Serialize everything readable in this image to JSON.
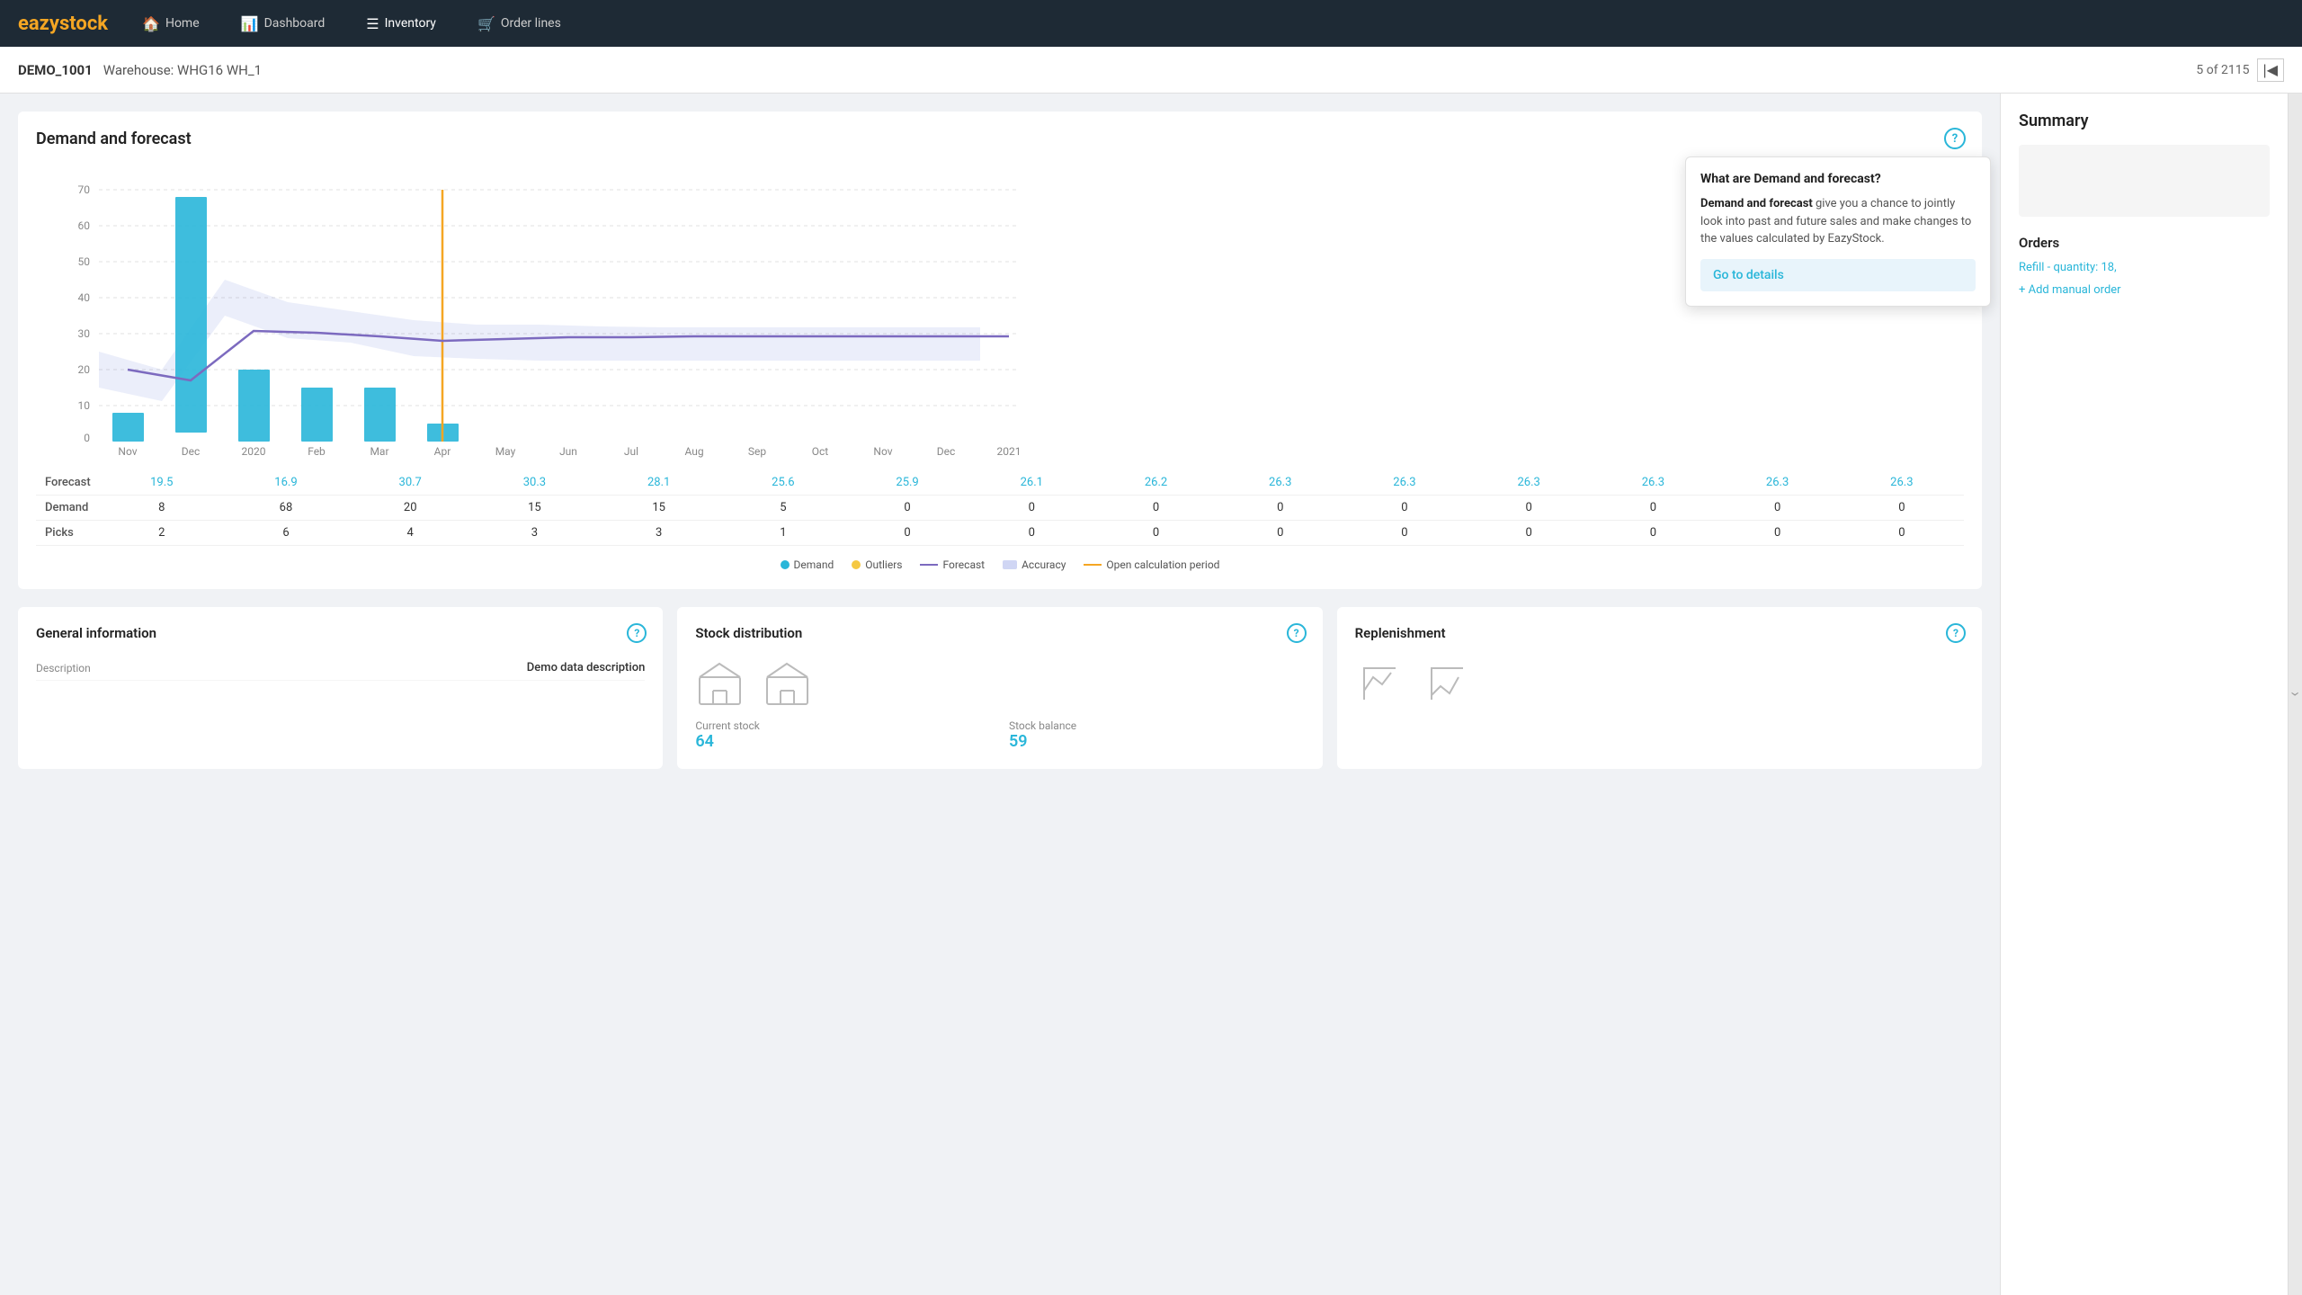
{
  "brand": {
    "name_plain": "eazy",
    "name_accent": "stock",
    "logo_text": "eazystock"
  },
  "navbar": {
    "items": [
      {
        "id": "home",
        "icon": "🏠",
        "label": "Home"
      },
      {
        "id": "dashboard",
        "icon": "📊",
        "label": "Dashboard"
      },
      {
        "id": "inventory",
        "icon": "≡",
        "label": "Inventory"
      },
      {
        "id": "orderlines",
        "icon": "🛒",
        "label": "Order lines"
      }
    ]
  },
  "breadcrumb": {
    "item_id": "DEMO_1001",
    "warehouse_label": "Warehouse: WHG16 WH_1",
    "pagination": "5 of 2115"
  },
  "chart": {
    "title": "Demand and forecast",
    "help_icon": "?",
    "x_labels": [
      "Nov",
      "Dec",
      "2020",
      "Feb",
      "Mar",
      "Apr",
      "May",
      "Jun",
      "Jul",
      "Aug",
      "Sep",
      "Oct",
      "Nov",
      "Dec",
      "2021"
    ],
    "y_labels": [
      "0",
      "10",
      "20",
      "30",
      "40",
      "50",
      "60",
      "70"
    ],
    "forecast_values": [
      19.5,
      16.9,
      30.7,
      30.3,
      28.1,
      25.6,
      25.9,
      26.1,
      26.2,
      26.3,
      26.3,
      26.3,
      26.3,
      26.3,
      26.3
    ],
    "demand_values": [
      8,
      68,
      20,
      15,
      15,
      5,
      0,
      0,
      0,
      0,
      0,
      0,
      0,
      0,
      0
    ],
    "picks_values": [
      2,
      6,
      4,
      3,
      3,
      1,
      0,
      0,
      0,
      0,
      0,
      0,
      0,
      0,
      0
    ],
    "legend": {
      "demand": "Demand",
      "outliers": "Outliers",
      "forecast": "Forecast",
      "accuracy": "Accuracy",
      "open_calc": "Open calculation period"
    }
  },
  "tooltip": {
    "title": "What are Demand and forecast?",
    "body_bold": "Demand and forecast",
    "body_text": " give you a chance to jointly look into past and future sales and make changes to the values calculated by EazyStock.",
    "link_text": "Go to details"
  },
  "general_info": {
    "title": "General information",
    "help_icon": "?",
    "rows": [
      {
        "label": "Description",
        "value": "Demo data description"
      }
    ]
  },
  "stock_distribution": {
    "title": "Stock distribution",
    "help_icon": "?",
    "rows": [
      {
        "label": "Current stock",
        "value": "64"
      },
      {
        "label": "Stock balance",
        "value": "59"
      }
    ]
  },
  "replenishment": {
    "title": "Replenishment",
    "help_icon": "?"
  },
  "summary": {
    "title": "Summary",
    "orders_title": "Orders",
    "refill_text": "Refill - quantity: 18,",
    "add_manual_text": "+ Add manual order"
  }
}
